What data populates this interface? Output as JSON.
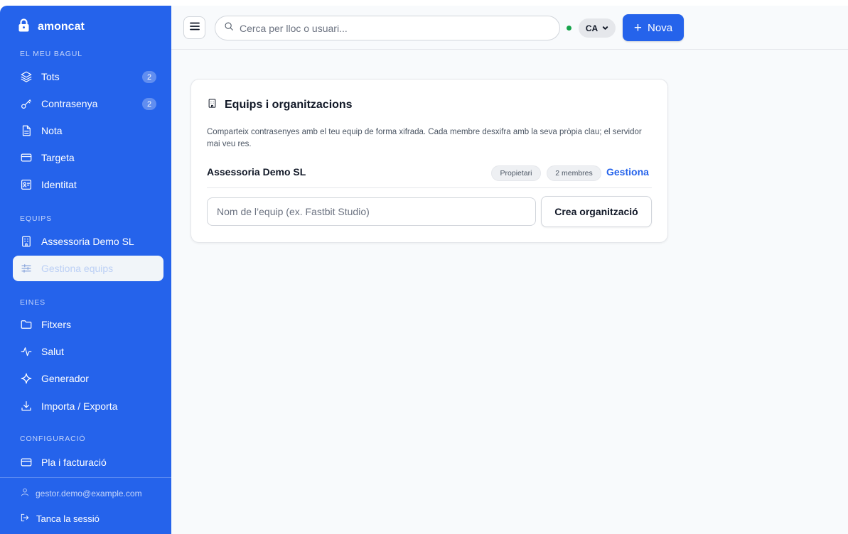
{
  "brand": {
    "name": "amoncat",
    "icon": "lock-icon"
  },
  "sidebar": {
    "sections": {
      "vault": "EL MEU BAGUL",
      "teams": "EQUIPS",
      "tools": "EINES",
      "config": "CONFIGURACIÓ"
    },
    "items": {
      "all": {
        "label": "Tots",
        "badge": "2",
        "icon": "layers-icon"
      },
      "password": {
        "label": "Contrasenya",
        "badge": "2",
        "icon": "key-icon"
      },
      "note": {
        "label": "Nota",
        "icon": "note-icon"
      },
      "card": {
        "label": "Targeta",
        "icon": "credit-card-icon"
      },
      "identity": {
        "label": "Identitat",
        "icon": "id-card-icon"
      },
      "team_demo": {
        "label": "Assessoria Demo SL",
        "icon": "building-icon"
      },
      "manage_teams": {
        "label": "Gestiona equips",
        "icon": "sliders-icon",
        "active": true
      },
      "files": {
        "label": "Fitxers",
        "icon": "folder-icon"
      },
      "health": {
        "label": "Salut",
        "icon": "pulse-icon"
      },
      "generator": {
        "label": "Generador",
        "icon": "sparkle-icon"
      },
      "import_export": {
        "label": "Importa / Exporta",
        "icon": "download-icon"
      },
      "billing": {
        "label": "Pla i facturació",
        "icon": "credit-card-icon"
      }
    },
    "user_email": "gestor.demo@example.com",
    "logout_label": "Tanca la sessió"
  },
  "topbar": {
    "search_placeholder": "Cerca per lloc o usuari...",
    "status_color": "#16a34a",
    "language": "CA",
    "new_button": "Nova"
  },
  "card": {
    "title": "Equips i organitzacions",
    "description": "Comparteix contrasenyes amb el teu equip de forma xifrada. Cada membre desxifra amb la seva pròpia clau; el servidor mai veu res.",
    "org": {
      "name": "Assessoria Demo SL",
      "role": "Propietari",
      "members": "2 membres",
      "manage_label": "Gestiona"
    },
    "team_name_placeholder": "Nom de l’equip (ex. Fastbit Studio)",
    "create_button": "Crea organització"
  },
  "colors": {
    "accent": "#2563eb",
    "sidebar_bg": "#2563eb",
    "main_bg": "#f8fafc"
  }
}
